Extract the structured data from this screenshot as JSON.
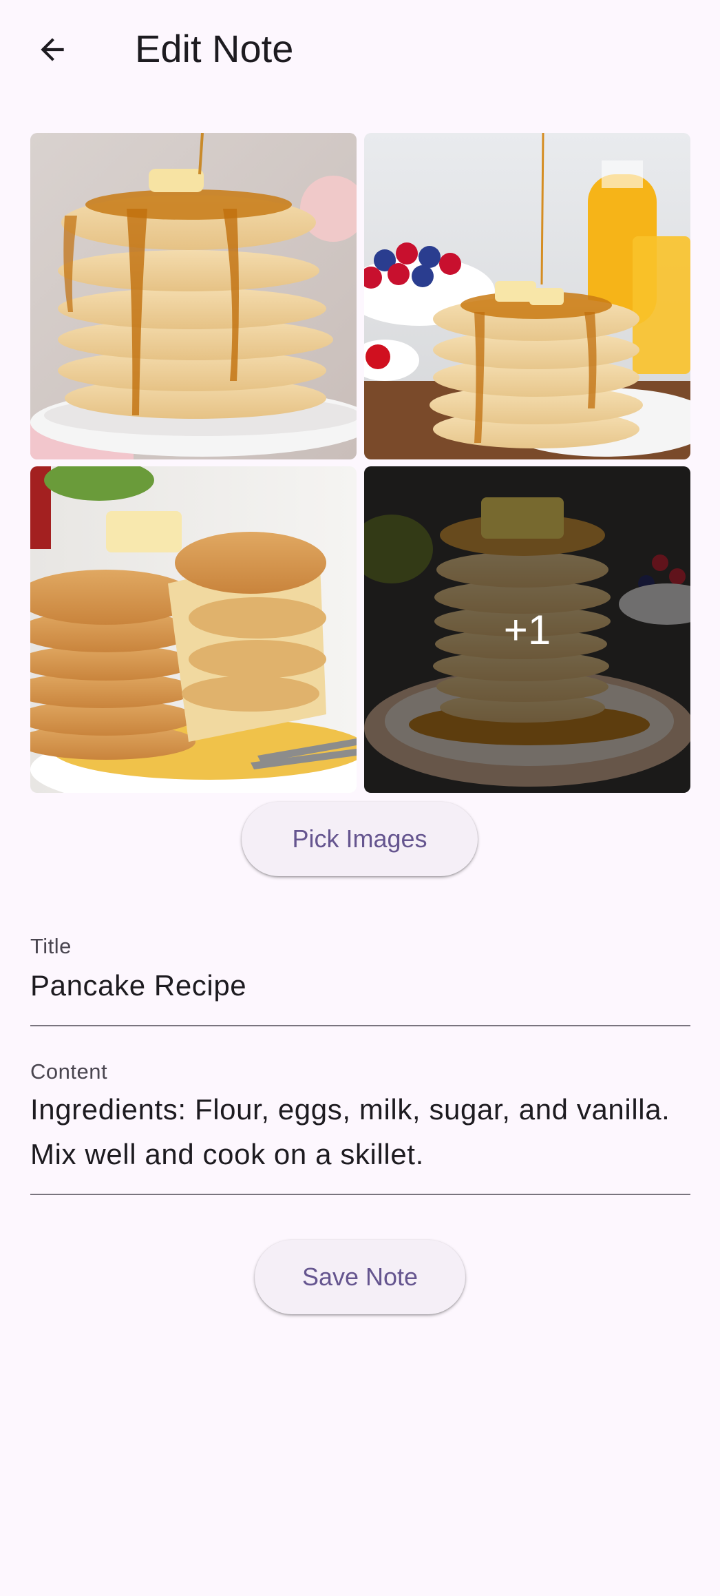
{
  "appbar": {
    "title": "Edit Note",
    "back_icon": "arrow-back-icon"
  },
  "images": [
    {
      "name": "pancake-stack-syrup"
    },
    {
      "name": "pancakes-berries-juice"
    },
    {
      "name": "pancakes-sliced-butter"
    },
    {
      "name": "pancakes-dark-background",
      "overlay_text": "+1"
    }
  ],
  "buttons": {
    "pick_images": "Pick Images",
    "save_note": "Save Note"
  },
  "form": {
    "title_label": "Title",
    "title_value": "Pancake Recipe",
    "content_label": "Content",
    "content_value": "Ingredients: Flour, eggs, milk, sugar, and vanilla. Mix well and cook on a skillet."
  },
  "colors": {
    "background": "#fdf7fe",
    "primary": "#65558f",
    "button_surface": "#f5eff7",
    "underline": "#79747e"
  }
}
